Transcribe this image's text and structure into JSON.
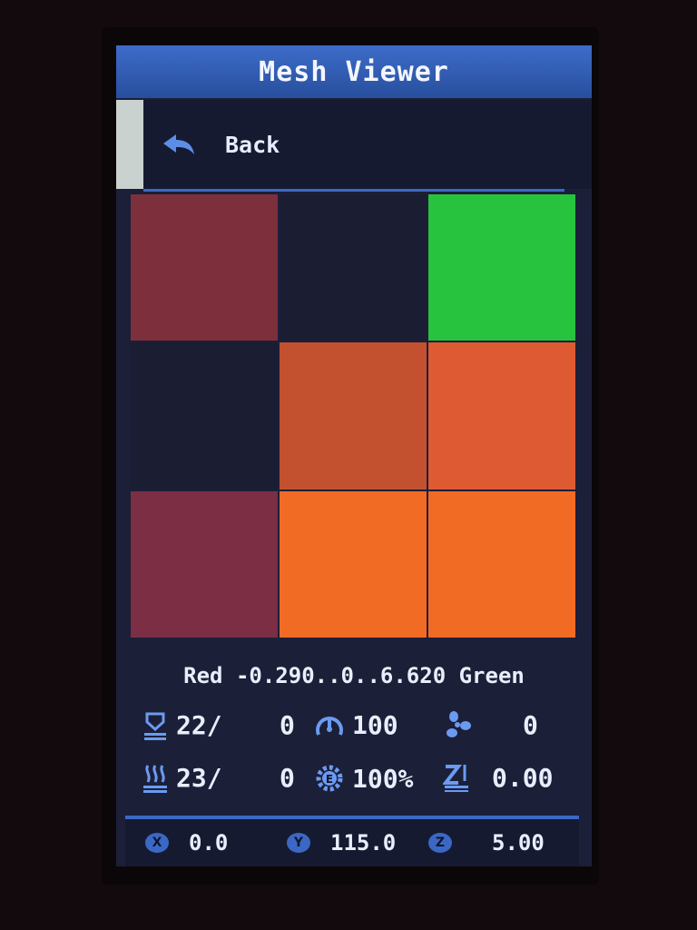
{
  "title": "Mesh Viewer",
  "back": {
    "label": "Back"
  },
  "mesh": {
    "rows": [
      [
        "#7e2f3c",
        "#1b1d33",
        "#28c33e"
      ],
      [
        "#1b1d33",
        "#c3512f",
        "#dd5a32"
      ],
      [
        "#7b2e44",
        "#f26b24",
        "#f26b24"
      ]
    ]
  },
  "legend": "Red -0.290..0..6.620 Green",
  "status": {
    "bed_temp": "22/",
    "bed_target": "0",
    "speed": "100",
    "fan": "0",
    "hotend_temp": "23/",
    "hotend_target": "0",
    "flow": "100%",
    "z_offset": "0.00"
  },
  "position": {
    "x_badge": "X",
    "x": "0.0",
    "y_badge": "Y",
    "y": "115.0",
    "z_badge": "Z",
    "z": "5.00"
  },
  "colors": {
    "title_bar": "#3d6cc9",
    "accent": "#3b68c4",
    "background": "#1b1f38"
  }
}
